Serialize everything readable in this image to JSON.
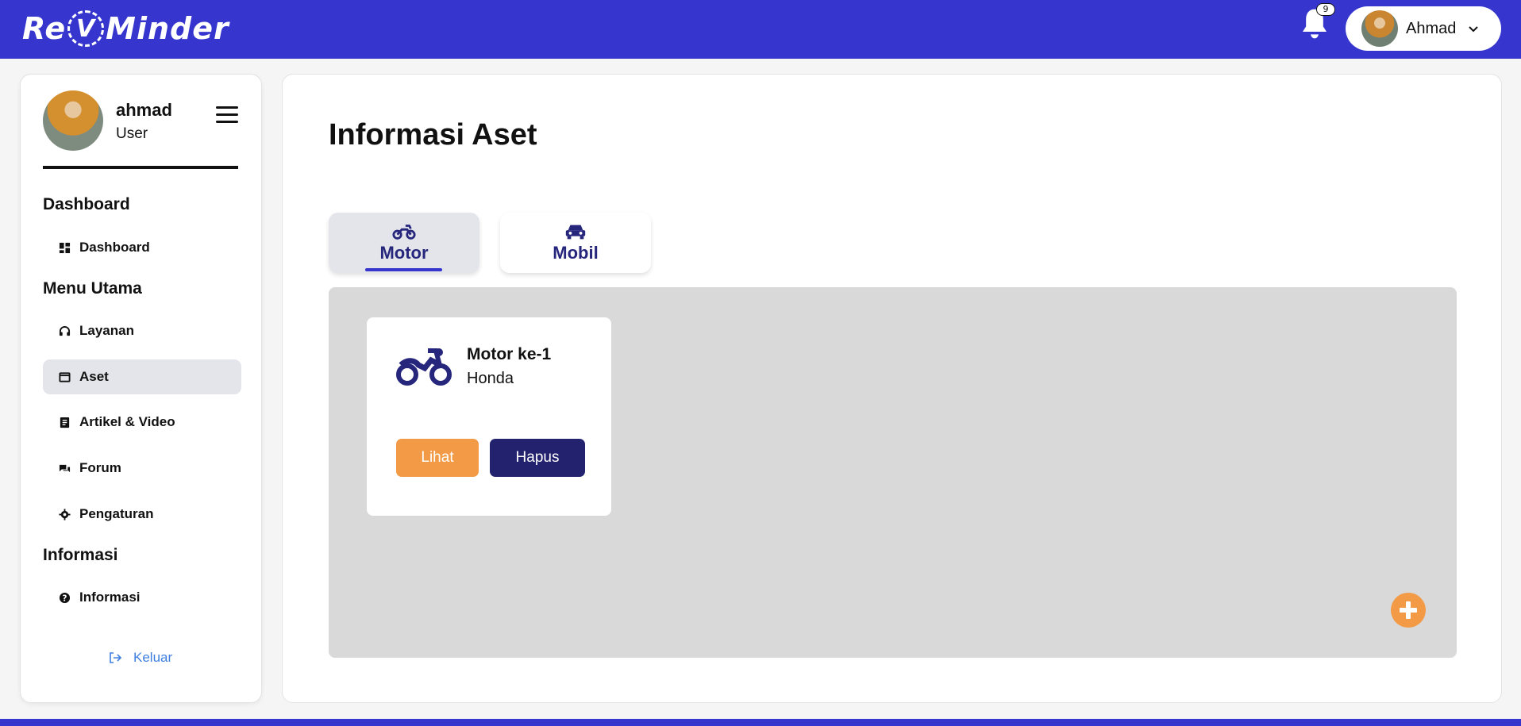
{
  "app": {
    "logo_text_left": "Re",
    "logo_text_mid": "V",
    "logo_text_right": "Minder"
  },
  "header": {
    "notification_count": "9",
    "user_name": "Ahmad",
    "bell_icon": "bell-icon",
    "dropdown_icon": "chevron-down-icon"
  },
  "sidebar": {
    "profile_name": "ahmad",
    "profile_role": "User",
    "sections": {
      "dashboard": "Dashboard",
      "main_menu": "Menu Utama",
      "info": "Informasi"
    },
    "items": [
      {
        "label": "Dashboard",
        "icon": "dashboard-icon"
      },
      {
        "label": "Layanan",
        "icon": "headset-icon"
      },
      {
        "label": "Aset",
        "icon": "window-icon",
        "active": true
      },
      {
        "label": "Artikel & Video",
        "icon": "article-icon"
      },
      {
        "label": "Forum",
        "icon": "chat-icon"
      },
      {
        "label": "Pengaturan",
        "icon": "gear-icon"
      },
      {
        "label": "Informasi",
        "icon": "question-icon"
      }
    ],
    "logout_label": "Keluar"
  },
  "main": {
    "title": "Informasi Aset",
    "tabs": [
      {
        "label": "Motor",
        "icon": "motorcycle-icon",
        "active": true
      },
      {
        "label": "Mobil",
        "icon": "car-icon",
        "active": false
      }
    ],
    "assets": [
      {
        "title": "Motor ke-1",
        "brand": "Honda",
        "icon": "motorcycle-icon",
        "view_label": "Lihat",
        "delete_label": "Hapus"
      }
    ],
    "add_icon": "plus-icon"
  },
  "colors": {
    "primary": "#3636cf",
    "navy": "#22226e",
    "accent": "#f29a45",
    "panel": "#d9d9d9",
    "link": "#3f7fe0"
  }
}
